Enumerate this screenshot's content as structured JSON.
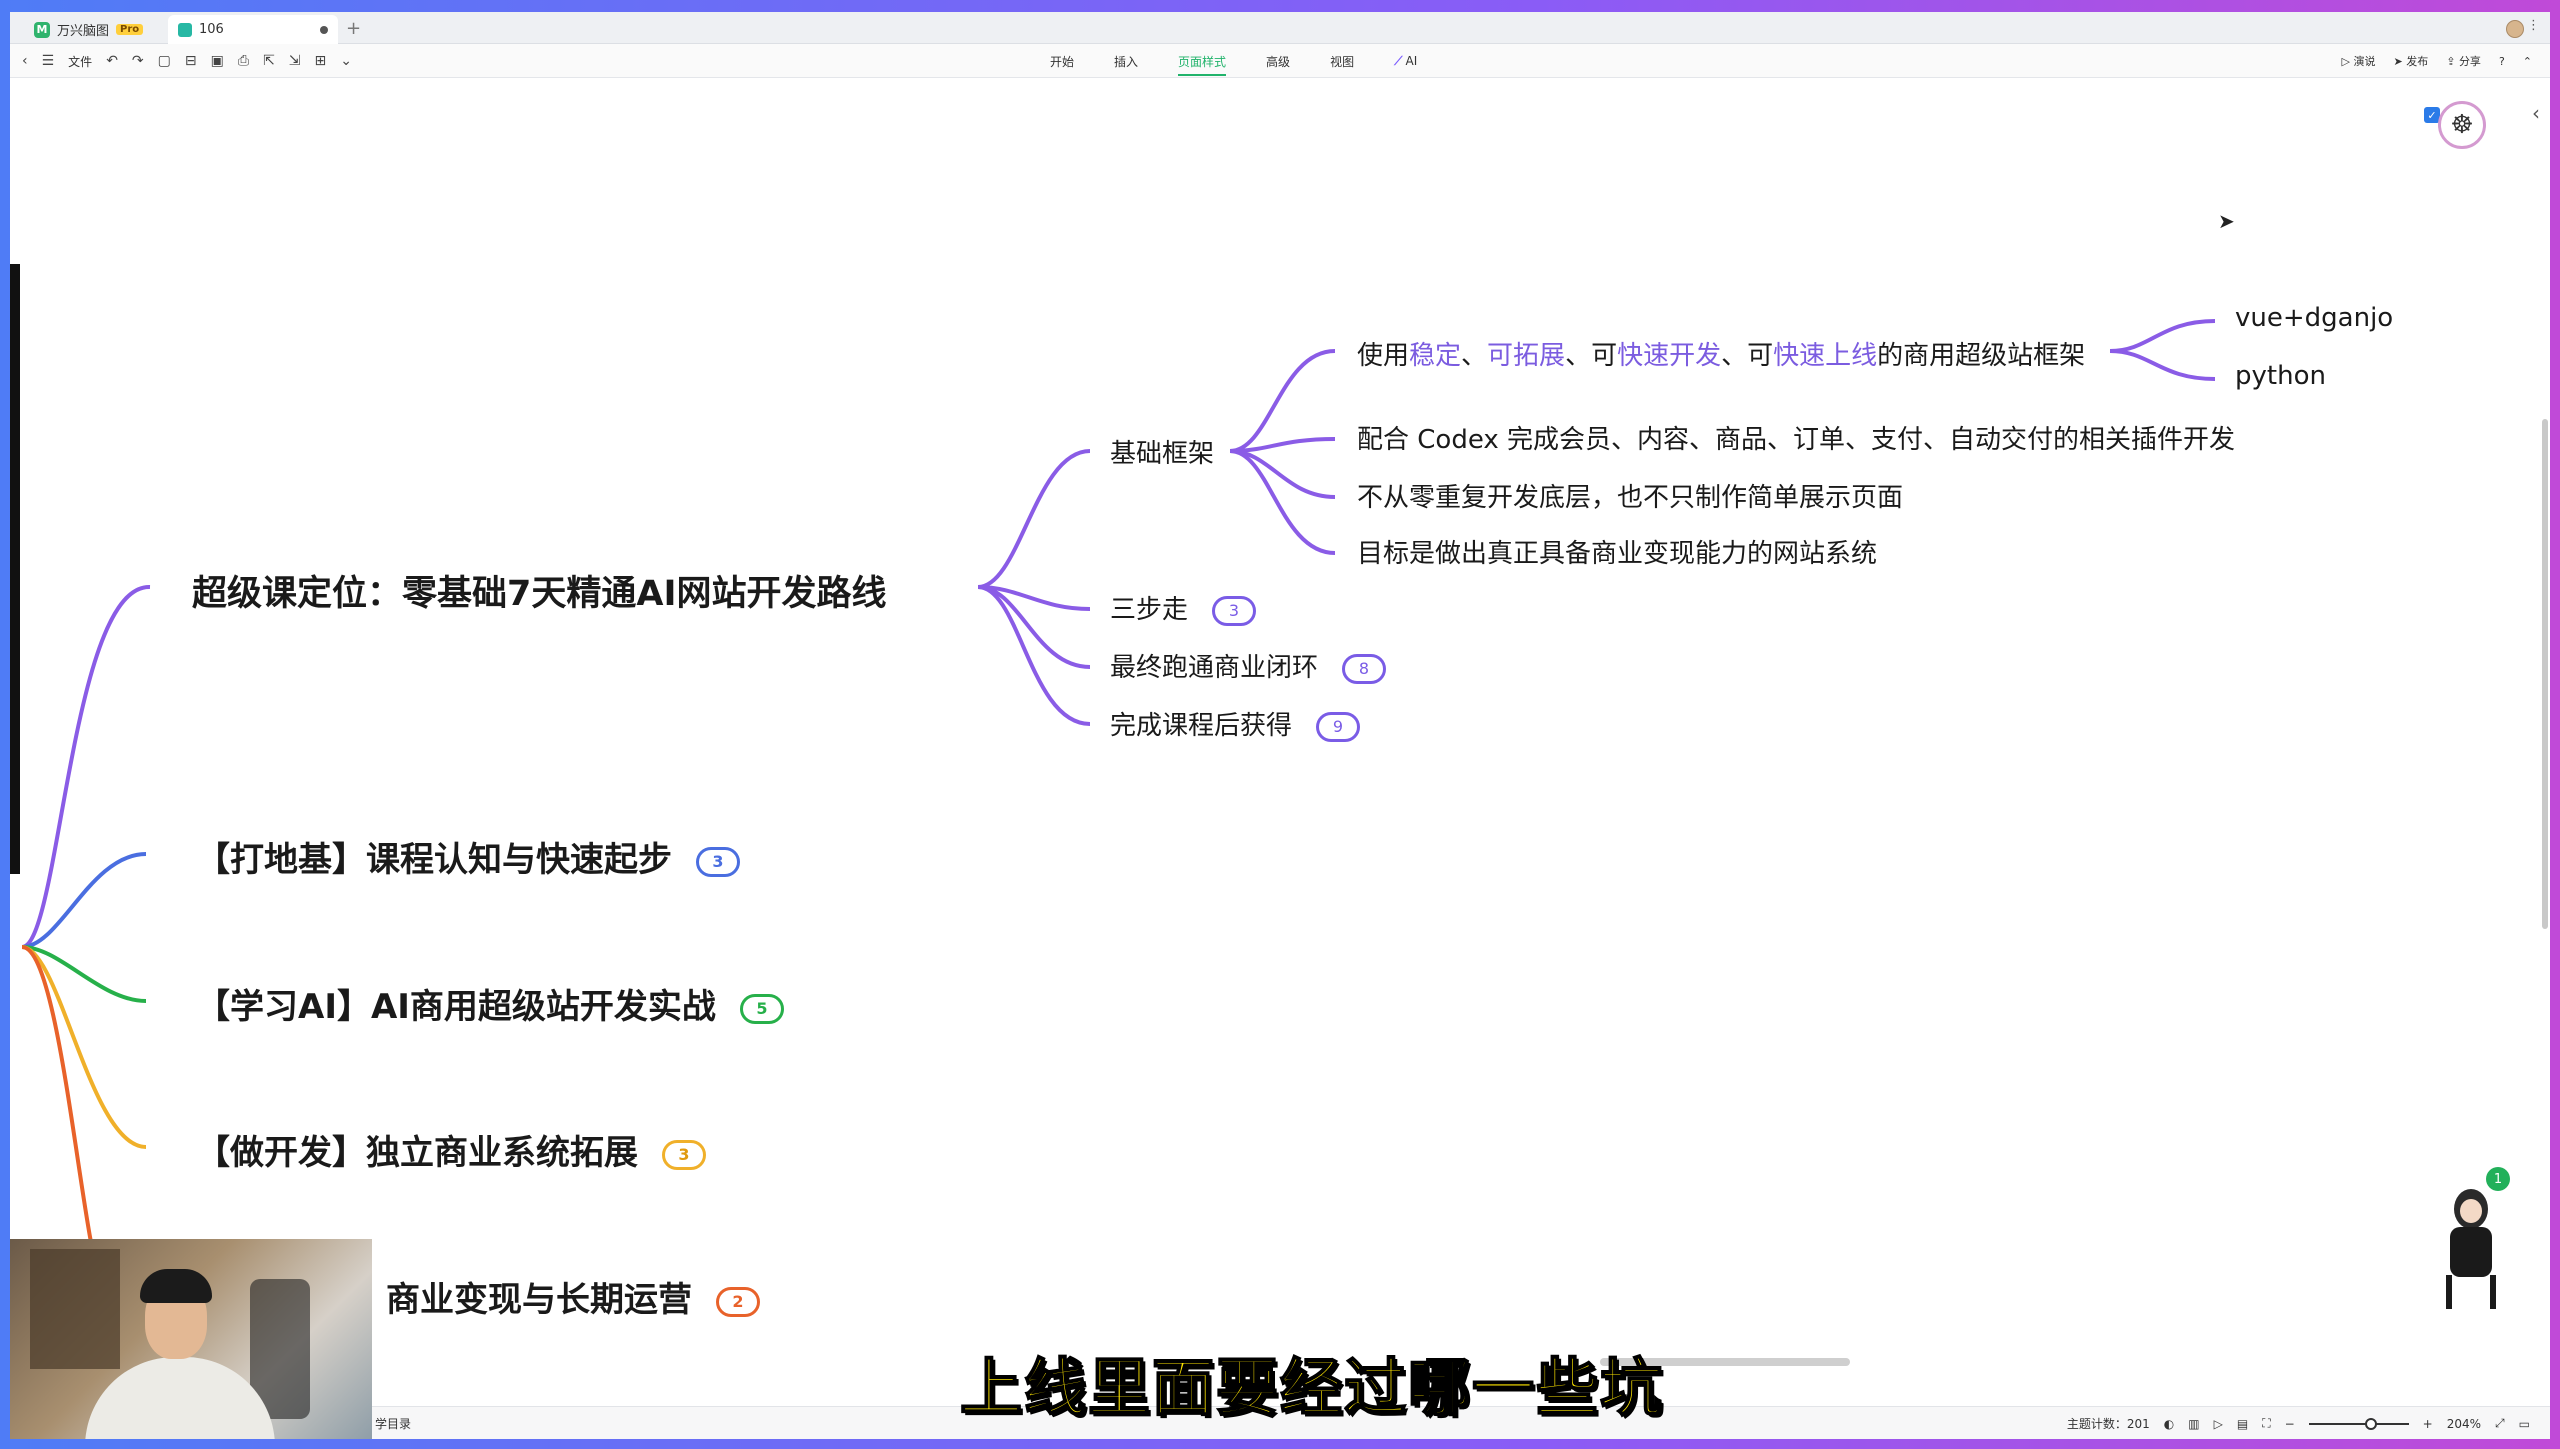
{
  "tabs": {
    "app_name": "万兴脑图",
    "pro_badge": "Pro",
    "doc_name": "106"
  },
  "toolbar": {
    "file_label": "文件",
    "menu": [
      "开始",
      "插入",
      "页面样式",
      "高级",
      "视图",
      "AI"
    ],
    "active_menu": "页面样式",
    "right": [
      "演说",
      "发布",
      "分享"
    ]
  },
  "mindmap": {
    "root": "超级课定位：零基础7天精通AI网站开发路线",
    "l2": [
      {
        "label": "基础框架"
      },
      {
        "label": "三步走",
        "count": "3"
      },
      {
        "label": "最终跑通商业闭环",
        "count": "8"
      },
      {
        "label": "完成课程后获得",
        "count": "9"
      }
    ],
    "l3": {
      "framework_parts": [
        "使用",
        "稳定",
        "、",
        "可拓展",
        "、可",
        "快速开发",
        "、可",
        "快速上线",
        "的商用超级站框架"
      ],
      "codex": "配合 Codex 完成会员、内容、商品、订单、支付、自动交付的相关插件开发",
      "no_rebuild": "不从零重复开发底层，也不只制作简单展示页面",
      "goal": "目标是做出真正具备商业变现能力的网站系统"
    },
    "l4": [
      "vue+dganjo",
      "python"
    ],
    "branches": [
      {
        "label": "【打地基】课程认知与快速起步",
        "count": "3",
        "color": "#4a6ee0"
      },
      {
        "label": "【学习AI】AI商用超级站开发实战",
        "count": "5",
        "color": "#27b04a"
      },
      {
        "label": "【做开发】独立商业系统拓展",
        "count": "3",
        "color": "#f0b02a"
      },
      {
        "label": "商业变现与长期运营",
        "count": "2",
        "color": "#e8622a"
      }
    ],
    "root_color": "#8a5ce6"
  },
  "statusbar": {
    "outline_label": "学目录",
    "topic_count": "主题计数：201",
    "zoom": "204%"
  },
  "notification_count": "1",
  "subtitle": "上线里面要经过哪一些坑"
}
